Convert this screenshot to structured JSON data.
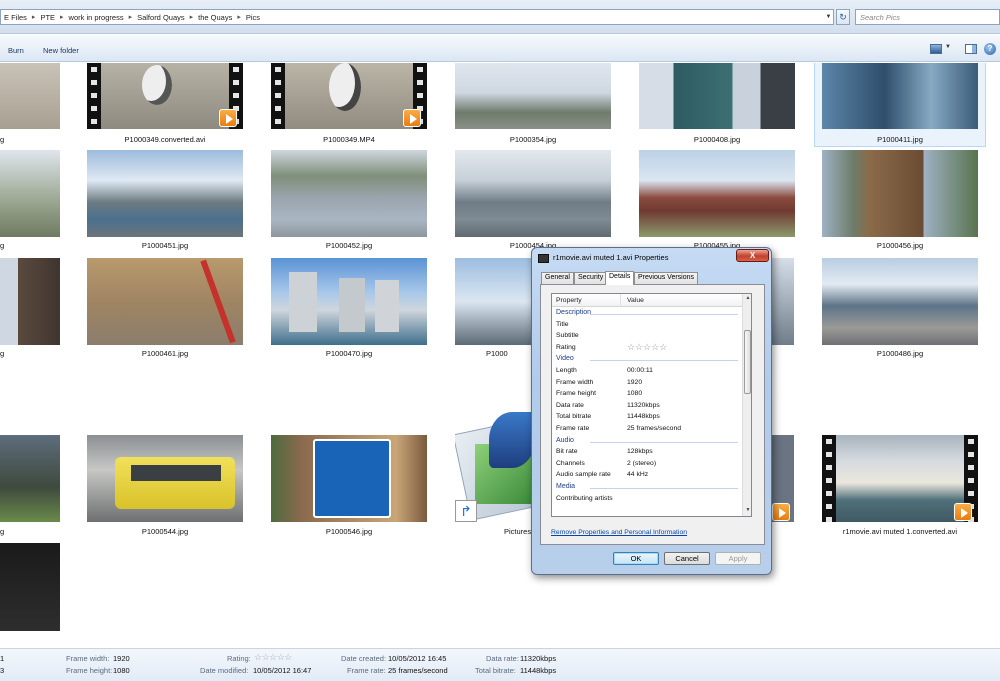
{
  "address": {
    "crumbs": [
      "E Files",
      "PTE",
      "work in progress",
      "Salford Quays",
      "the Quays",
      "Pics"
    ],
    "search_placeholder": "Search Pics"
  },
  "toolbar": {
    "burn": "Burn",
    "new_folder": "New folder"
  },
  "files": [
    {
      "label": "g"
    },
    {
      "label": "P1000349.converted.avi"
    },
    {
      "label": "P1000349.MP4"
    },
    {
      "label": "P1000354.jpg"
    },
    {
      "label": "P1000408.jpg"
    },
    {
      "label": "P1000411.jpg"
    },
    {
      "label": "g"
    },
    {
      "label": "P1000451.jpg"
    },
    {
      "label": "P1000452.jpg"
    },
    {
      "label": "P1000454.jpg"
    },
    {
      "label": "P1000455.jpg"
    },
    {
      "label": "P1000456.jpg"
    },
    {
      "label": "g"
    },
    {
      "label": "P1000461.jpg"
    },
    {
      "label": "P1000470.jpg"
    },
    {
      "label": "P1000"
    },
    {
      "label": "P1000486.jpg"
    },
    {
      "label": "g"
    },
    {
      "label": "P1000544.jpg"
    },
    {
      "label": "P1000546.jpg"
    },
    {
      "label": "Pictures"
    },
    {
      "label": "r1movie.avi muted 1.converted.avi"
    }
  ],
  "details": {
    "left_1": "1",
    "left_2": "3",
    "frame_width_label": "Frame width:",
    "frame_width": "1920",
    "frame_height_label": "Frame height:",
    "frame_height": "1080",
    "rating_label": "Rating:",
    "date_modified_label": "Date modified:",
    "date_modified": "10/05/2012 16:47",
    "date_created_label": "Date created:",
    "date_created": "10/05/2012 16:45",
    "frame_rate_label": "Frame rate:",
    "frame_rate": "25 frames/second",
    "data_rate_label": "Data rate:",
    "data_rate": "11320kbps",
    "total_bitrate_label": "Total bitrate:",
    "total_bitrate": "11448kbps"
  },
  "dialog": {
    "title": "r1movie.avi muted 1.avi Properties",
    "close": "X",
    "tabs": [
      "General",
      "Security",
      "Details",
      "Previous Versions"
    ],
    "active_tab": "Details",
    "columns": {
      "property": "Property",
      "value": "Value"
    },
    "rows": [
      {
        "group": true,
        "name": "Description"
      },
      {
        "name": "Title",
        "value": ""
      },
      {
        "name": "Subtitle",
        "value": ""
      },
      {
        "name": "Rating",
        "value": "",
        "stars": true
      },
      {
        "group": true,
        "name": "Video"
      },
      {
        "name": "Length",
        "value": "00:00:11"
      },
      {
        "name": "Frame width",
        "value": "1920"
      },
      {
        "name": "Frame height",
        "value": "1080"
      },
      {
        "name": "Data rate",
        "value": "11320kbps"
      },
      {
        "name": "Total bitrate",
        "value": "11448kbps"
      },
      {
        "name": "Frame rate",
        "value": "25 frames/second"
      },
      {
        "group": true,
        "name": "Audio"
      },
      {
        "name": "Bit rate",
        "value": "128kbps"
      },
      {
        "name": "Channels",
        "value": "2 (stereo)"
      },
      {
        "name": "Audio sample rate",
        "value": "44 kHz"
      },
      {
        "group": true,
        "name": "Media"
      },
      {
        "name": "Contributing artists",
        "value": ""
      }
    ],
    "remove_link": "Remove Properties and Personal Information",
    "buttons": {
      "ok": "OK",
      "cancel": "Cancel",
      "apply": "Apply"
    }
  },
  "colors": {
    "selection": "#eaf3fc",
    "link": "#0645ad",
    "vlc_orange": "#f08a1c"
  }
}
